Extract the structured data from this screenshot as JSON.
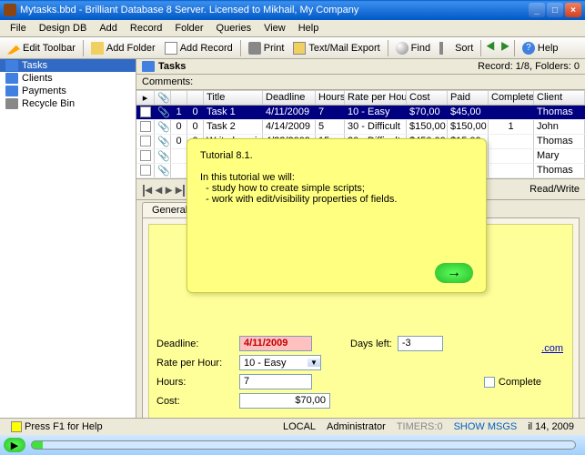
{
  "title": "Mytasks.bbd - Brilliant Database 8 Server. Licensed to Mikhail, My Company",
  "menu": [
    "File",
    "Design DB",
    "Add",
    "Record",
    "Folder",
    "Queries",
    "View",
    "Help"
  ],
  "toolbar": {
    "edit": "Edit Toolbar",
    "addFolder": "Add Folder",
    "addRecord": "Add Record",
    "print": "Print",
    "export": "Text/Mail Export",
    "find": "Find",
    "sort": "Sort",
    "help": "Help"
  },
  "tree": [
    "Tasks",
    "Clients",
    "Payments",
    "Recycle Bin"
  ],
  "header": {
    "title": "Tasks",
    "record": "Record: 1/8, Folders: 0"
  },
  "comments": "Comments:",
  "cols": [
    "",
    "",
    "",
    "",
    "Title",
    "Deadline",
    "Hours",
    "Rate per Hou",
    "Cost",
    "Paid",
    "Complete",
    "Client"
  ],
  "rows": [
    {
      "a": "1",
      "b": "0",
      "title": "Task 1",
      "dead": "4/11/2009",
      "hours": "7",
      "rate": "10 - Easy",
      "cost": "$70,00",
      "paid": "$45,00",
      "comp": "",
      "client": "Thomas",
      "sel": true
    },
    {
      "a": "0",
      "b": "0",
      "title": "Task 2",
      "dead": "4/14/2009",
      "hours": "5",
      "rate": "30 - Difficult",
      "cost": "$150,00",
      "paid": "$150,00",
      "comp": "1",
      "client": "John"
    },
    {
      "a": "0",
      "b": "0",
      "title": "Write b-script",
      "dead": "4/22/2009",
      "hours": "15",
      "rate": "30 - Difficult",
      "cost": "$450,00",
      "paid": "$15,00",
      "comp": "",
      "client": "Thomas"
    },
    {
      "a": "",
      "b": "",
      "title": "",
      "dead": "",
      "hours": "",
      "rate": "",
      "cost": "",
      "paid": "",
      "comp": "",
      "client": "Mary"
    },
    {
      "a": "",
      "b": "",
      "title": "",
      "dead": "",
      "hours": "",
      "rate": "",
      "cost": "",
      "paid": "",
      "comp": "",
      "client": "Thomas"
    }
  ],
  "rw": "Read/Write",
  "tab": "General",
  "form": {
    "deadline_l": "Deadline:",
    "deadline_v": "4/11/2009",
    "days_l": "Days left:",
    "days_v": "-3",
    "rate_l": "Rate per Hour:",
    "rate_v": "10 - Easy",
    "hours_l": "Hours:",
    "hours_v": "7",
    "cost_l": "Cost:",
    "cost_v": "$70,00",
    "complete_l": "Complete",
    "com_link": ".com"
  },
  "tutorial": {
    "title": "Tutorial 8.1.",
    "intro": "In this tutorial we will:",
    "b1": "  - study how to create simple scripts;",
    "b2": "  - work with edit/visibility properties of fields."
  },
  "status": {
    "hint": "Press F1 for Help",
    "local": "LOCAL",
    "admin": "Administrator",
    "timers": "TIMERS:0",
    "msgs": "SHOW MSGS",
    "date": "il 14, 2009"
  }
}
